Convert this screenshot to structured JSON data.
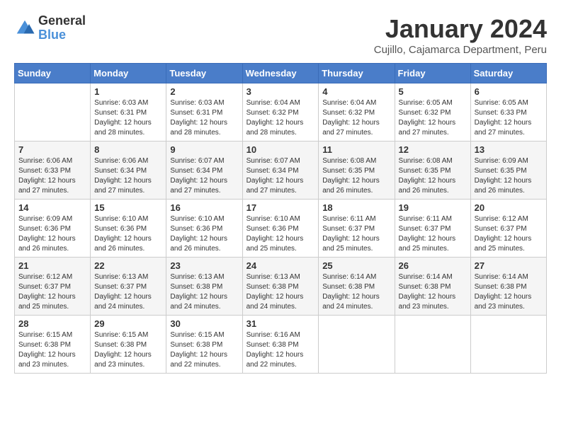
{
  "header": {
    "logo_line1": "General",
    "logo_line2": "Blue",
    "month_year": "January 2024",
    "location": "Cujillo, Cajamarca Department, Peru"
  },
  "calendar": {
    "days_of_week": [
      "Sunday",
      "Monday",
      "Tuesday",
      "Wednesday",
      "Thursday",
      "Friday",
      "Saturday"
    ],
    "weeks": [
      [
        {
          "day": "",
          "sunrise": "",
          "sunset": "",
          "daylight": ""
        },
        {
          "day": "1",
          "sunrise": "Sunrise: 6:03 AM",
          "sunset": "Sunset: 6:31 PM",
          "daylight": "Daylight: 12 hours and 28 minutes."
        },
        {
          "day": "2",
          "sunrise": "Sunrise: 6:03 AM",
          "sunset": "Sunset: 6:31 PM",
          "daylight": "Daylight: 12 hours and 28 minutes."
        },
        {
          "day": "3",
          "sunrise": "Sunrise: 6:04 AM",
          "sunset": "Sunset: 6:32 PM",
          "daylight": "Daylight: 12 hours and 28 minutes."
        },
        {
          "day": "4",
          "sunrise": "Sunrise: 6:04 AM",
          "sunset": "Sunset: 6:32 PM",
          "daylight": "Daylight: 12 hours and 27 minutes."
        },
        {
          "day": "5",
          "sunrise": "Sunrise: 6:05 AM",
          "sunset": "Sunset: 6:32 PM",
          "daylight": "Daylight: 12 hours and 27 minutes."
        },
        {
          "day": "6",
          "sunrise": "Sunrise: 6:05 AM",
          "sunset": "Sunset: 6:33 PM",
          "daylight": "Daylight: 12 hours and 27 minutes."
        }
      ],
      [
        {
          "day": "7",
          "sunrise": "Sunrise: 6:06 AM",
          "sunset": "Sunset: 6:33 PM",
          "daylight": "Daylight: 12 hours and 27 minutes."
        },
        {
          "day": "8",
          "sunrise": "Sunrise: 6:06 AM",
          "sunset": "Sunset: 6:34 PM",
          "daylight": "Daylight: 12 hours and 27 minutes."
        },
        {
          "day": "9",
          "sunrise": "Sunrise: 6:07 AM",
          "sunset": "Sunset: 6:34 PM",
          "daylight": "Daylight: 12 hours and 27 minutes."
        },
        {
          "day": "10",
          "sunrise": "Sunrise: 6:07 AM",
          "sunset": "Sunset: 6:34 PM",
          "daylight": "Daylight: 12 hours and 27 minutes."
        },
        {
          "day": "11",
          "sunrise": "Sunrise: 6:08 AM",
          "sunset": "Sunset: 6:35 PM",
          "daylight": "Daylight: 12 hours and 26 minutes."
        },
        {
          "day": "12",
          "sunrise": "Sunrise: 6:08 AM",
          "sunset": "Sunset: 6:35 PM",
          "daylight": "Daylight: 12 hours and 26 minutes."
        },
        {
          "day": "13",
          "sunrise": "Sunrise: 6:09 AM",
          "sunset": "Sunset: 6:35 PM",
          "daylight": "Daylight: 12 hours and 26 minutes."
        }
      ],
      [
        {
          "day": "14",
          "sunrise": "Sunrise: 6:09 AM",
          "sunset": "Sunset: 6:36 PM",
          "daylight": "Daylight: 12 hours and 26 minutes."
        },
        {
          "day": "15",
          "sunrise": "Sunrise: 6:10 AM",
          "sunset": "Sunset: 6:36 PM",
          "daylight": "Daylight: 12 hours and 26 minutes."
        },
        {
          "day": "16",
          "sunrise": "Sunrise: 6:10 AM",
          "sunset": "Sunset: 6:36 PM",
          "daylight": "Daylight: 12 hours and 26 minutes."
        },
        {
          "day": "17",
          "sunrise": "Sunrise: 6:10 AM",
          "sunset": "Sunset: 6:36 PM",
          "daylight": "Daylight: 12 hours and 25 minutes."
        },
        {
          "day": "18",
          "sunrise": "Sunrise: 6:11 AM",
          "sunset": "Sunset: 6:37 PM",
          "daylight": "Daylight: 12 hours and 25 minutes."
        },
        {
          "day": "19",
          "sunrise": "Sunrise: 6:11 AM",
          "sunset": "Sunset: 6:37 PM",
          "daylight": "Daylight: 12 hours and 25 minutes."
        },
        {
          "day": "20",
          "sunrise": "Sunrise: 6:12 AM",
          "sunset": "Sunset: 6:37 PM",
          "daylight": "Daylight: 12 hours and 25 minutes."
        }
      ],
      [
        {
          "day": "21",
          "sunrise": "Sunrise: 6:12 AM",
          "sunset": "Sunset: 6:37 PM",
          "daylight": "Daylight: 12 hours and 25 minutes."
        },
        {
          "day": "22",
          "sunrise": "Sunrise: 6:13 AM",
          "sunset": "Sunset: 6:37 PM",
          "daylight": "Daylight: 12 hours and 24 minutes."
        },
        {
          "day": "23",
          "sunrise": "Sunrise: 6:13 AM",
          "sunset": "Sunset: 6:38 PM",
          "daylight": "Daylight: 12 hours and 24 minutes."
        },
        {
          "day": "24",
          "sunrise": "Sunrise: 6:13 AM",
          "sunset": "Sunset: 6:38 PM",
          "daylight": "Daylight: 12 hours and 24 minutes."
        },
        {
          "day": "25",
          "sunrise": "Sunrise: 6:14 AM",
          "sunset": "Sunset: 6:38 PM",
          "daylight": "Daylight: 12 hours and 24 minutes."
        },
        {
          "day": "26",
          "sunrise": "Sunrise: 6:14 AM",
          "sunset": "Sunset: 6:38 PM",
          "daylight": "Daylight: 12 hours and 23 minutes."
        },
        {
          "day": "27",
          "sunrise": "Sunrise: 6:14 AM",
          "sunset": "Sunset: 6:38 PM",
          "daylight": "Daylight: 12 hours and 23 minutes."
        }
      ],
      [
        {
          "day": "28",
          "sunrise": "Sunrise: 6:15 AM",
          "sunset": "Sunset: 6:38 PM",
          "daylight": "Daylight: 12 hours and 23 minutes."
        },
        {
          "day": "29",
          "sunrise": "Sunrise: 6:15 AM",
          "sunset": "Sunset: 6:38 PM",
          "daylight": "Daylight: 12 hours and 23 minutes."
        },
        {
          "day": "30",
          "sunrise": "Sunrise: 6:15 AM",
          "sunset": "Sunset: 6:38 PM",
          "daylight": "Daylight: 12 hours and 22 minutes."
        },
        {
          "day": "31",
          "sunrise": "Sunrise: 6:16 AM",
          "sunset": "Sunset: 6:38 PM",
          "daylight": "Daylight: 12 hours and 22 minutes."
        },
        {
          "day": "",
          "sunrise": "",
          "sunset": "",
          "daylight": ""
        },
        {
          "day": "",
          "sunrise": "",
          "sunset": "",
          "daylight": ""
        },
        {
          "day": "",
          "sunrise": "",
          "sunset": "",
          "daylight": ""
        }
      ]
    ]
  }
}
